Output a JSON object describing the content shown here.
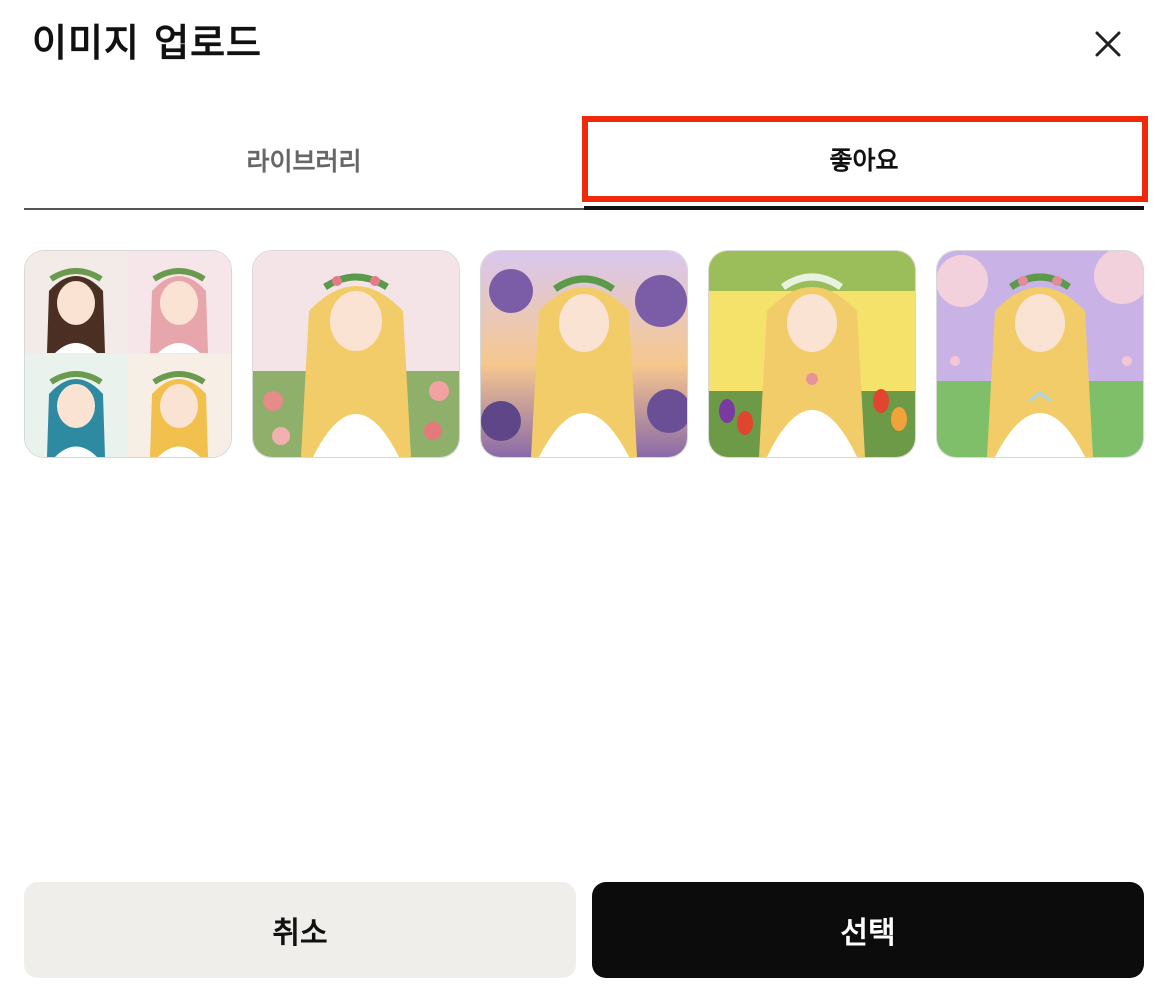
{
  "dialog": {
    "title": "이미지 업로드",
    "close_icon": "close-icon"
  },
  "tabs": [
    {
      "label": "라이브러리",
      "active": false
    },
    {
      "label": "좋아요",
      "active": true
    }
  ],
  "highlight_color": "#ef2a0c",
  "images": [
    {
      "kind": "four-character grid: brown, pink, teal, blonde hair with flower crowns"
    },
    {
      "kind": "blonde girl with rose crown in rose garden"
    },
    {
      "kind": "blonde girl in lilac field at sunset"
    },
    {
      "kind": "blonde girl among tulips under yellow sky"
    },
    {
      "kind": "blonde girl under cherry blossoms on purple field"
    }
  ],
  "footer": {
    "cancel_label": "취소",
    "select_label": "선택"
  },
  "colors": {
    "cancel_bg": "#efeeeb",
    "select_bg": "#0c0c0c",
    "active_tab_underline": "#111111"
  }
}
